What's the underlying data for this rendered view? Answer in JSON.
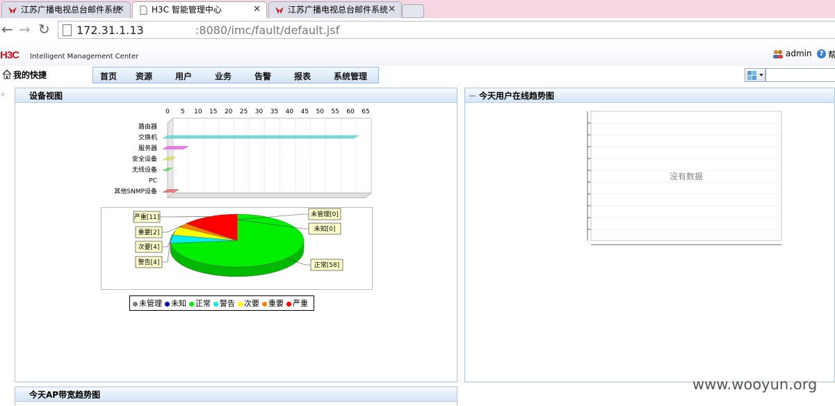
{
  "browser": {
    "tabs": [
      {
        "title": "江苏广播电视总台邮件系统",
        "icon": "mail-logo-icon"
      },
      {
        "title": "H3C 智能管理中心",
        "icon": "page-icon"
      },
      {
        "title": "江苏广播电视总台邮件系统",
        "icon": "mail-logo-icon"
      }
    ],
    "url_host": "172.31.1.13",
    "url_rest": ":8080/imc/fault/default.jsf"
  },
  "app": {
    "logo": "H3C",
    "logo_sub": "Intelligent Management Center",
    "user": "admin",
    "help_text": "帮",
    "quick_label": "我的快捷",
    "menu": [
      "首页",
      "资源",
      "用户",
      "业务",
      "告警",
      "报表",
      "系统管理"
    ],
    "search_value": ""
  },
  "panels": {
    "device_view": "设备视图",
    "online_users": "今天用户在线趋势图",
    "ap_bandwidth": "今天AP带宽趋势图",
    "no_data": "没有数据"
  },
  "chart_data": [
    {
      "type": "bar",
      "orientation": "horizontal",
      "categories": [
        "路由器",
        "交换机",
        "服务器",
        "安全设备",
        "无线设备",
        "PC",
        "其他SNMP设备"
      ],
      "values": [
        0,
        63,
        7,
        3,
        2,
        0,
        4
      ],
      "xlim": [
        0,
        65
      ],
      "ticks": [
        0,
        5,
        10,
        15,
        20,
        25,
        30,
        35,
        40,
        45,
        50,
        55,
        60,
        65
      ],
      "colors": [
        "#8ce0e0",
        "#70d0d0",
        "#e070e0",
        "#d8d860",
        "#70d070",
        "#999999",
        "#e07070"
      ],
      "grid": true
    },
    {
      "type": "pie",
      "labels": [
        "未管理",
        "未知",
        "正常",
        "警告",
        "次要",
        "重要",
        "严重"
      ],
      "values": [
        0,
        0,
        58,
        4,
        4,
        2,
        11
      ],
      "callouts": [
        "未管理[0]",
        "未知[0]",
        "正常[58]",
        "警告[4]",
        "次要[4]",
        "重要[2]",
        "严重[11]"
      ],
      "colors": [
        "#808080",
        "#0000cc",
        "#00ee00",
        "#00eeee",
        "#ffff00",
        "#ff8000",
        "#ff0000"
      ],
      "legend": "bottom"
    }
  ]
}
